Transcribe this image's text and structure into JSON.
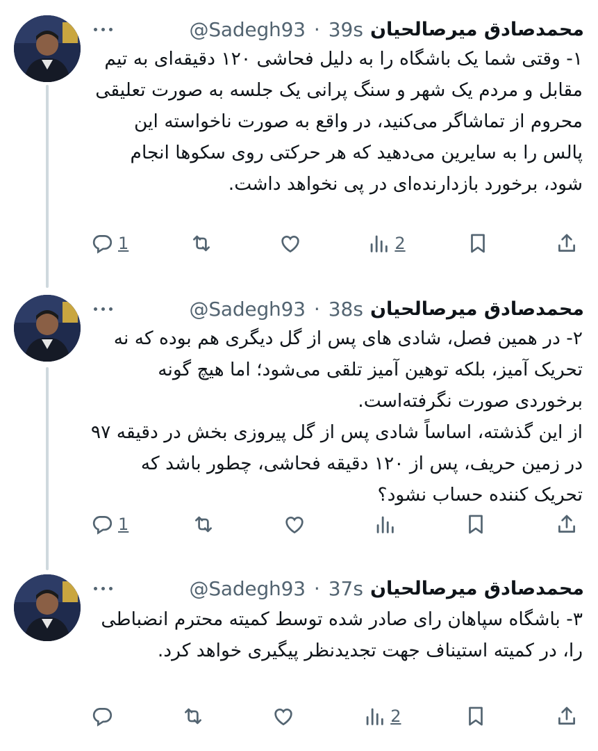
{
  "tweets": [
    {
      "name": "محمدصادق میرصالحیان",
      "handle": "@Sadegh93",
      "separator": "·",
      "time": "39s",
      "text": "۱- وقتی شما یک باشگاه را به دلیل فحاشی ۱۲۰ دقیقه‌ای به تیم مقابل و مردم یک شهر و سنگ پرانی یک جلسه به صورت تعلیقی محروم از تماشاگر می‌کنید، در واقع به صورت ناخواسته این پالس را به سایرین می‌دهید که هر حرکتی روی سکوها انجام شود، برخورد بازدارنده‌ای در پی نخواهد داشت.",
      "reply_count": "1",
      "retweet_count": "",
      "like_count": "",
      "view_count": "2"
    },
    {
      "name": "محمدصادق میرصالحیان",
      "handle": "@Sadegh93",
      "separator": "·",
      "time": "38s",
      "text": "۲- در همین فصل، شادی های پس از گل دیگری هم بوده که نه تحریک آمیز، بلکه توهین آمیز تلقی می‌شود؛ اما هیچ گونه برخوردی صورت نگرفته‌است.\nاز این گذشته، اساساً شادی پس از گل پیروزی بخش در دقیقه ۹۷ در زمین حریف، پس از ۱۲۰ دقیقه فحاشی، چطور باشد که تحریک کننده حساب نشود؟",
      "reply_count": "1",
      "retweet_count": "",
      "like_count": "",
      "view_count": ""
    },
    {
      "name": "محمدصادق میرصالحیان",
      "handle": "@Sadegh93",
      "separator": "·",
      "time": "37s",
      "text": "۳- باشگاه سپاهان رای صادر شده توسط کمیته محترم انضباطی را، در کمیته استیناف جهت تجدیدنظر پیگیری خواهد کرد.",
      "reply_count": "",
      "retweet_count": "",
      "like_count": "",
      "view_count": "2"
    }
  ],
  "icons": {
    "reply": "reply-icon",
    "retweet": "retweet-icon",
    "like": "like-icon",
    "views": "views-icon",
    "bookmark": "bookmark-icon",
    "share": "share-icon",
    "more": "more-icon"
  },
  "colors": {
    "text": "#0f1419",
    "secondary": "#536471",
    "connector": "#cfd9de",
    "background": "#ffffff"
  }
}
